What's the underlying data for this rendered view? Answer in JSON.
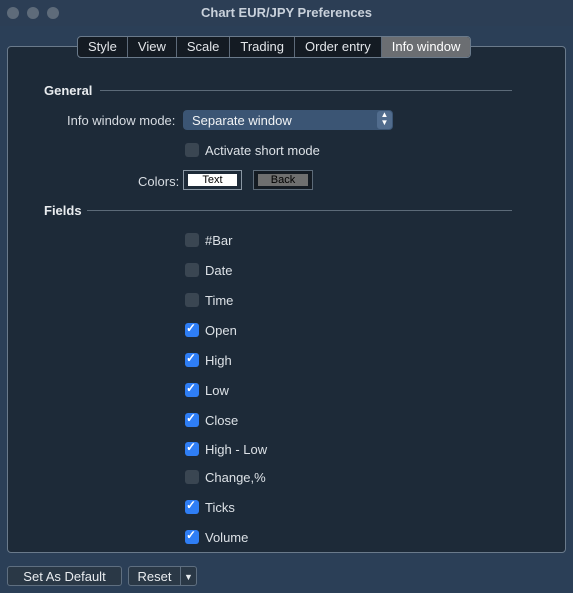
{
  "window": {
    "title": "Chart EUR/JPY Preferences"
  },
  "tabs": [
    {
      "label": "Style",
      "active": false
    },
    {
      "label": "View",
      "active": false
    },
    {
      "label": "Scale",
      "active": false
    },
    {
      "label": "Trading",
      "active": false
    },
    {
      "label": "Order entry",
      "active": false
    },
    {
      "label": "Info window",
      "active": true
    }
  ],
  "general": {
    "header": "General",
    "mode_label": "Info window mode:",
    "mode_value": "Separate window",
    "short_mode_label": "Activate short mode",
    "short_mode_checked": false,
    "colors_label": "Colors:",
    "text_color_label": "Text",
    "back_color_label": "Back"
  },
  "fields": {
    "header": "Fields",
    "items": [
      {
        "label": "#Bar",
        "checked": false
      },
      {
        "label": "Date",
        "checked": false
      },
      {
        "label": "Time",
        "checked": false
      },
      {
        "label": "Open",
        "checked": true
      },
      {
        "label": "High",
        "checked": true
      },
      {
        "label": "Low",
        "checked": true
      },
      {
        "label": "Close",
        "checked": true
      },
      {
        "label": "High - Low",
        "checked": true
      },
      {
        "label": "Change,%",
        "checked": false
      },
      {
        "label": "Ticks",
        "checked": true
      },
      {
        "label": "Volume",
        "checked": true
      }
    ]
  },
  "footer": {
    "set_default_label": "Set As Default",
    "reset_label": "Reset"
  },
  "colors": {
    "accent": "#2f7ef5",
    "panel": "#1d2a38",
    "window_bg": "#2b3f57"
  }
}
